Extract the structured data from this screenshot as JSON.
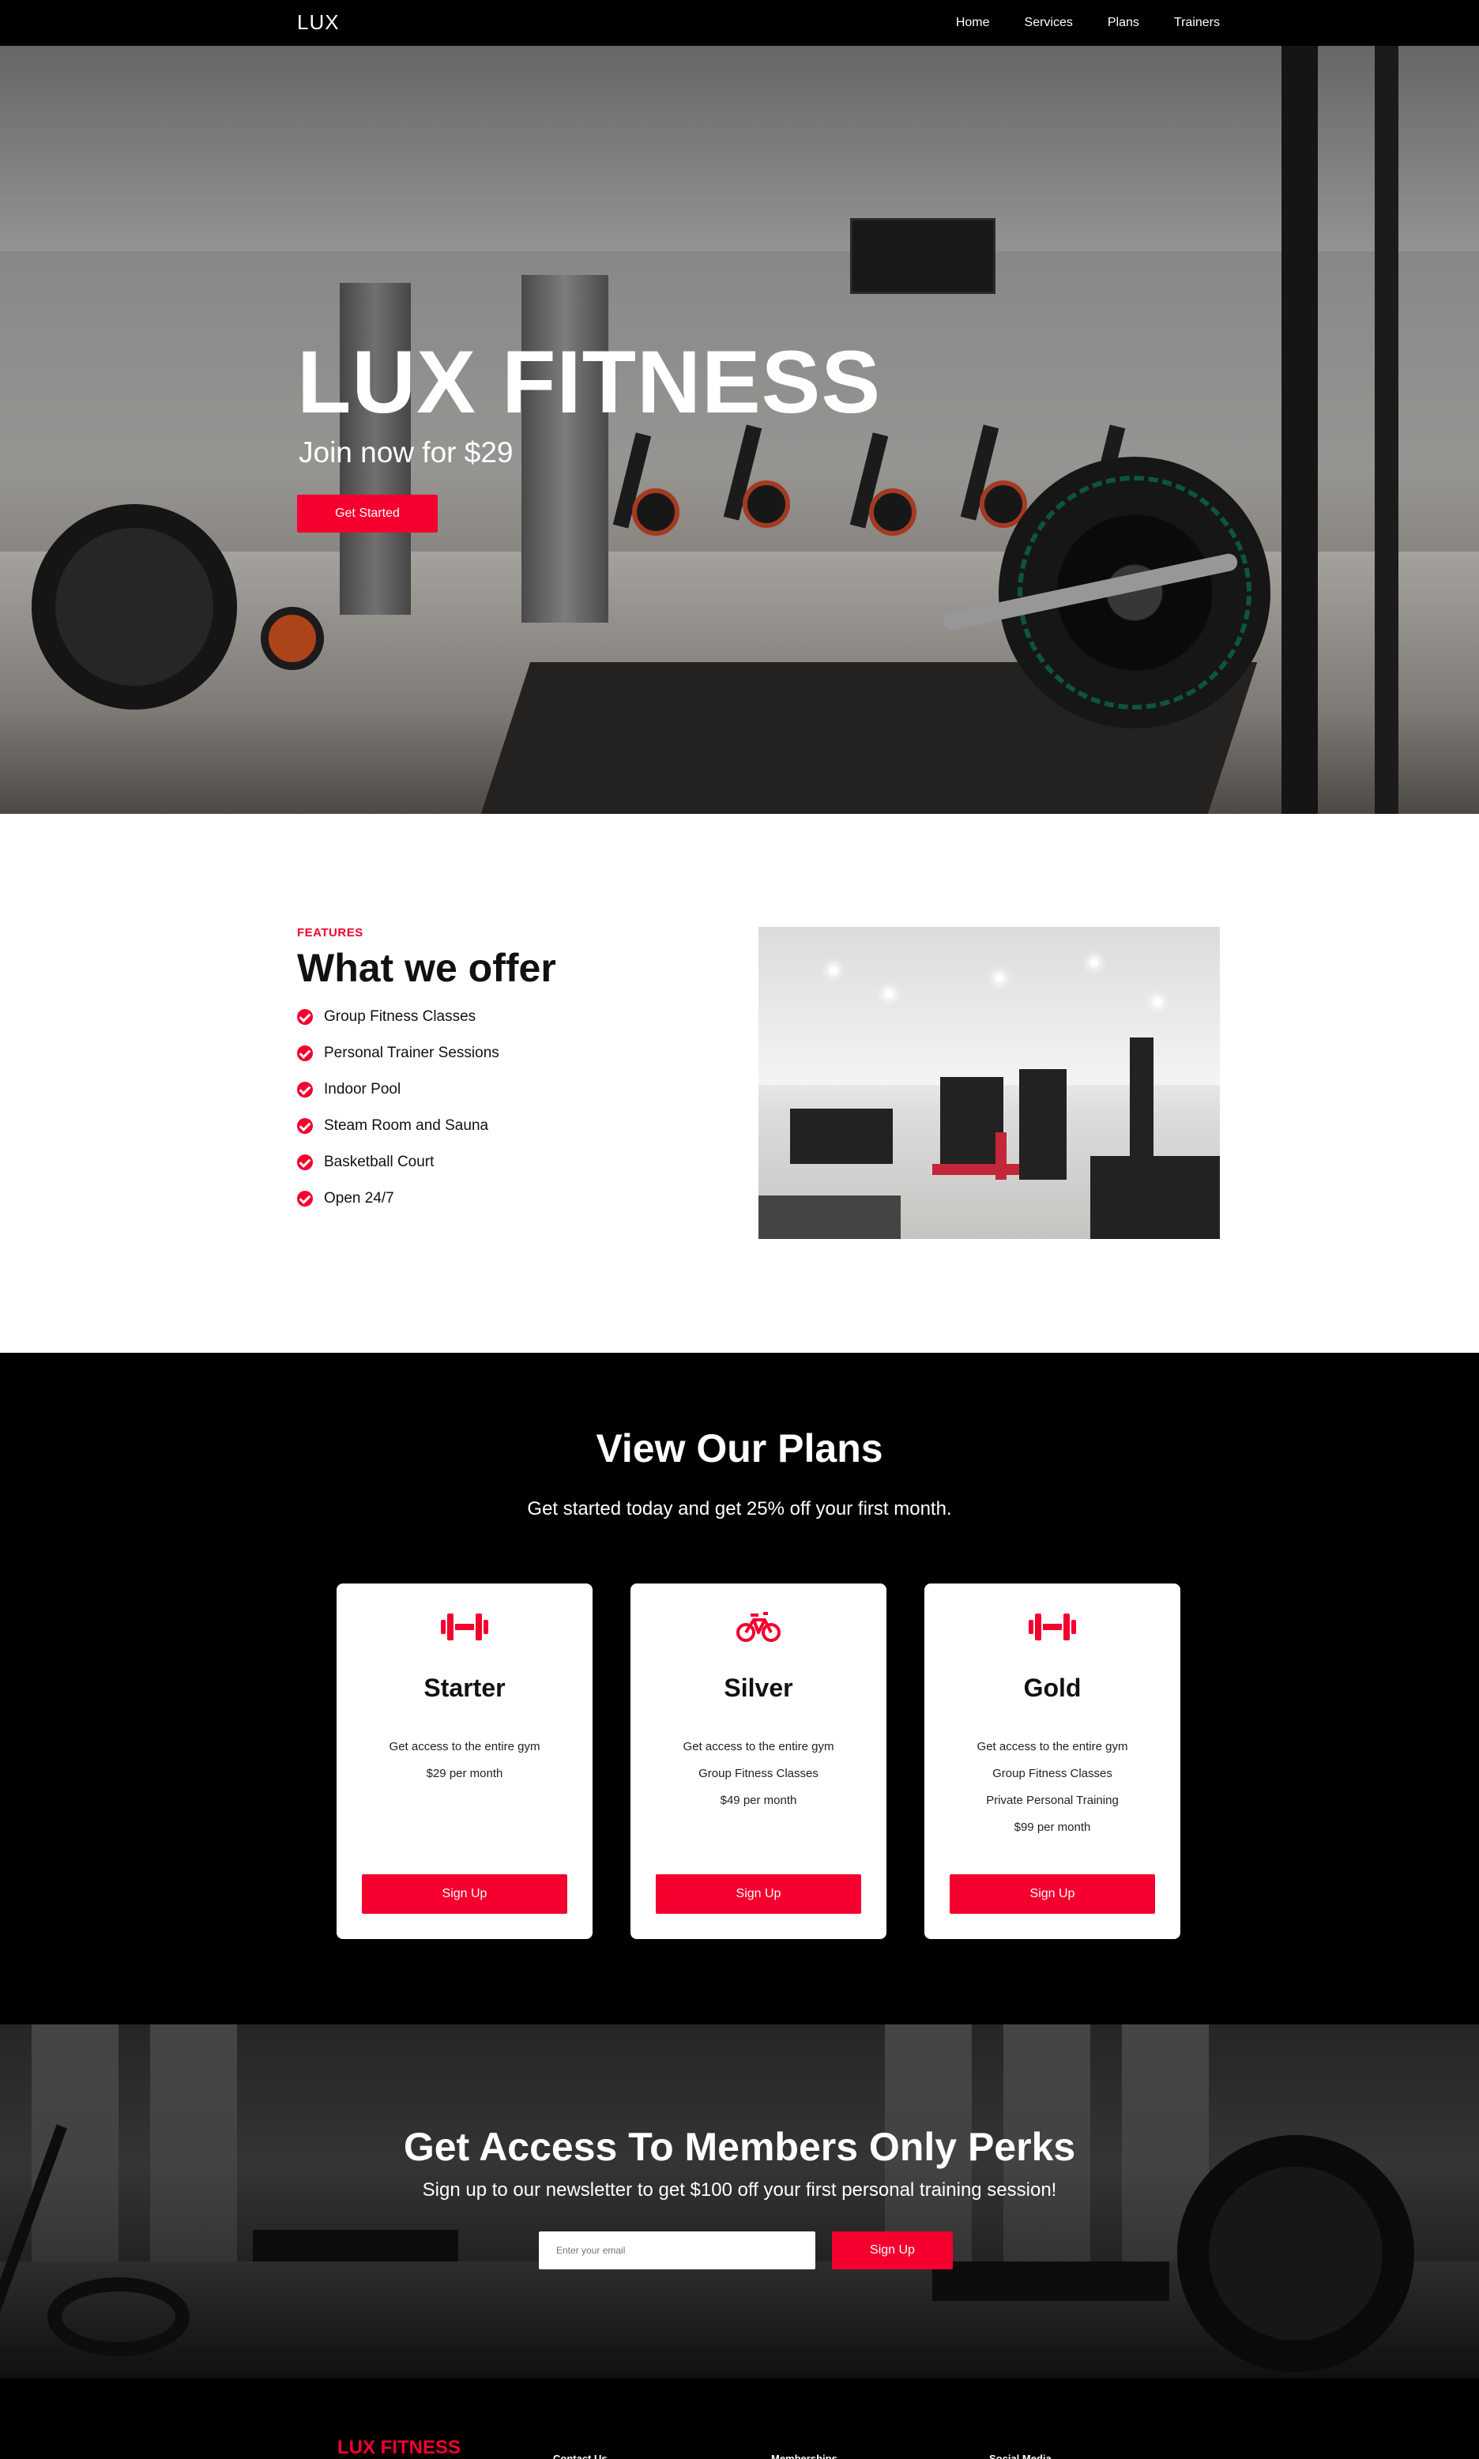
{
  "nav": {
    "logo": "LUX",
    "links": [
      "Home",
      "Services",
      "Plans",
      "Trainers"
    ]
  },
  "hero": {
    "title": "LUX FITNESS",
    "subtitle": "Join now for $29",
    "cta_label": "Get Started"
  },
  "features": {
    "eyebrow": "FEATURES",
    "heading": "What we offer",
    "items": [
      "Group Fitness Classes",
      "Personal Trainer Sessions",
      "Indoor Pool",
      "Steam Room and Sauna",
      "Basketball Court",
      "Open 24/7"
    ]
  },
  "plans": {
    "heading": "View Our Plans",
    "tagline": "Get started today and get 25% off your first month.",
    "cards": [
      {
        "icon": "dumbbell-icon",
        "name": "Starter",
        "lines": [
          "Get access to the entire gym",
          "$29 per month"
        ],
        "button": "Sign Up"
      },
      {
        "icon": "bicycle-icon",
        "name": "Silver",
        "lines": [
          "Get access to the entire gym",
          "Group Fitness Classes",
          "$49 per month"
        ],
        "button": "Sign Up"
      },
      {
        "icon": "dumbbell-icon",
        "name": "Gold",
        "lines": [
          "Get access to the entire gym",
          "Group Fitness Classes",
          "Private Personal Training",
          "$99 per month"
        ],
        "button": "Sign Up"
      }
    ]
  },
  "newsletter": {
    "heading": "Get Access To Members Only Perks",
    "text": "Sign up to our newsletter to get $100 off your first personal training session!",
    "email_placeholder": "Enter your email",
    "button": "Sign Up"
  },
  "footer": {
    "brand": "LUX FITNESS",
    "columns": [
      "Contact Us",
      "Memberships",
      "Social Media"
    ]
  },
  "colors": {
    "accent": "#f5002e",
    "dark": "#000000",
    "light": "#ffffff"
  }
}
